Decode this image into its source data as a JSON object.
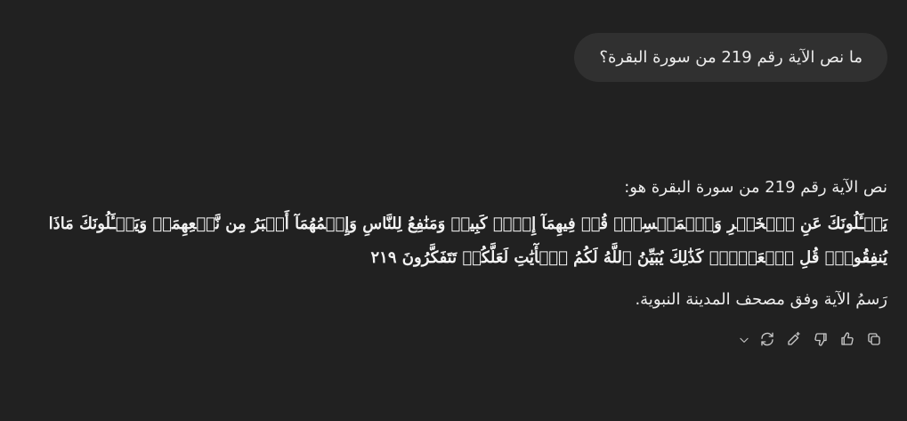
{
  "user_message": {
    "text": "ما نص الآية رقم 219 من سورة البقرة؟"
  },
  "assistant_message": {
    "intro": "نص الآية رقم 219 من سورة البقرة هو:",
    "verse": "يَسۡـَٔلُونَكَ عَنِ ٱلۡخَمۡرِ وَٱلۡمَيۡسِرِۖ قُلۡ فِيهِمَآ إِثۡمٞ كَبِيرٞ وَمَنَٰفِعُ لِلنَّاسِ وَإِثۡمُهُمَآ أَكۡبَرُ مِن نَّفۡعِهِمَاۗ وَيَسۡـَٔلُونَكَ مَاذَا يُنفِقُونَۖ قُلِ ٱلۡعَفۡوَۗ كَذَٰلِكَ يُبَيِّنُ ٱللَّهُ لَكُمُ ٱلۡأٓيَٰتِ لَعَلَّكُمۡ تَتَفَكَّرُونَ ٢١٩",
    "note": "رَسمُ الآية وفق مصحف المدينة النبوية."
  },
  "actions": [
    {
      "name": "copy-icon"
    },
    {
      "name": "thumbs-up-icon"
    },
    {
      "name": "thumbs-down-icon"
    },
    {
      "name": "edit-sparkle-icon"
    },
    {
      "name": "regenerate-icon"
    },
    {
      "name": "chevron-down-icon"
    }
  ]
}
